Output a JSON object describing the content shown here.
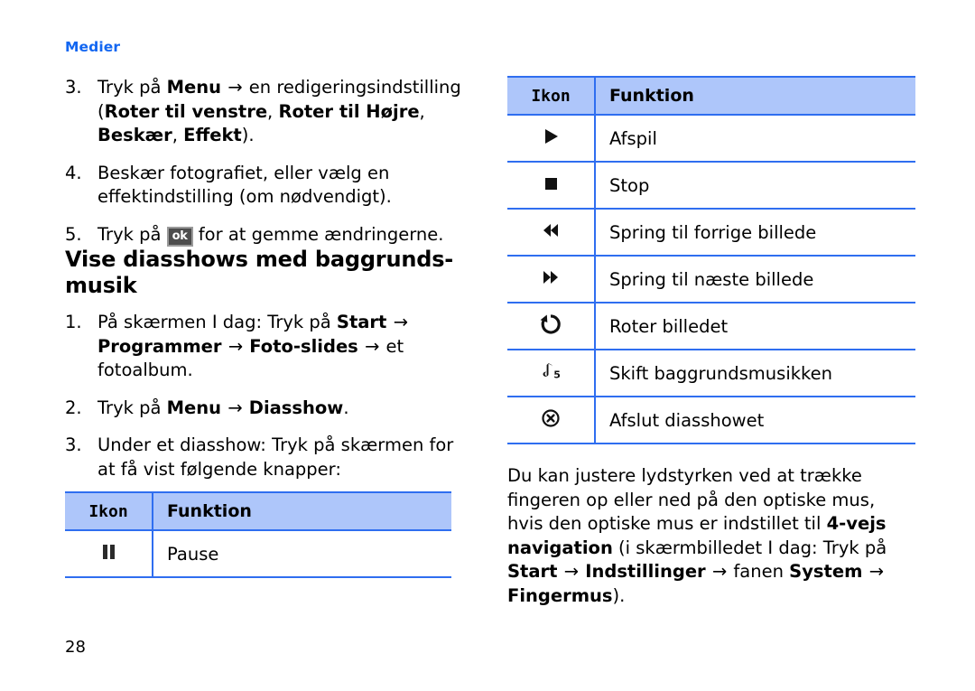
{
  "running_head": "Medier",
  "folio": "28",
  "colors": {
    "accent_blue": "#1266f1",
    "table_border": "#2f6ef0",
    "table_header_fill": "#aec6fa",
    "ok_key_fill": "#4d4d4d"
  },
  "left_column": {
    "steps_photo_edit": [
      {
        "num": "3.",
        "parts": [
          {
            "t": "Tryk på ",
            "b": false
          },
          {
            "t": "Menu",
            "b": true
          },
          {
            "t": " → ",
            "b": false,
            "arrow": true
          },
          {
            "t": "en redigeringsindstilling (",
            "b": false
          },
          {
            "t": "Roter til venstre",
            "b": true
          },
          {
            "t": ", ",
            "b": false
          },
          {
            "t": "Roter til Højre",
            "b": true
          },
          {
            "t": ", ",
            "b": false
          },
          {
            "t": "Beskær",
            "b": true
          },
          {
            "t": ", ",
            "b": false
          },
          {
            "t": "Effekt",
            "b": true
          },
          {
            "t": ").",
            "b": false
          }
        ]
      },
      {
        "num": "4.",
        "parts": [
          {
            "t": "Beskær fotografiet, eller vælg en effektindstilling (om nødvendigt).",
            "b": false
          }
        ]
      },
      {
        "num": "5.",
        "parts": [
          {
            "t": "Tryk på ",
            "b": false
          },
          {
            "t": "ok",
            "key": true
          },
          {
            "t": " for at gemme ændringerne.",
            "b": false
          }
        ]
      }
    ],
    "section_heading": "Vise diasshows med baggrunds-musik",
    "steps_slideshow": [
      {
        "num": "1.",
        "parts": [
          {
            "t": "På skærmen I dag: Tryk på ",
            "b": false
          },
          {
            "t": "Start",
            "b": true
          },
          {
            "t": " → ",
            "b": false,
            "arrow": true
          },
          {
            "t": "Programmer",
            "b": true
          },
          {
            "t": " → ",
            "b": false,
            "arrow": true
          },
          {
            "t": "Foto-slides",
            "b": true
          },
          {
            "t": " → ",
            "b": false,
            "arrow": true
          },
          {
            "t": "et fotoalbum.",
            "b": false
          }
        ]
      },
      {
        "num": "2.",
        "parts": [
          {
            "t": "Tryk på ",
            "b": false
          },
          {
            "t": "Menu",
            "b": true
          },
          {
            "t": " → ",
            "b": false,
            "arrow": true
          },
          {
            "t": "Diasshow",
            "b": true
          },
          {
            "t": ".",
            "b": false
          }
        ]
      },
      {
        "num": "3.",
        "parts": [
          {
            "t": "Under et diasshow: Tryk på skærmen for at få vist følgende knapper:",
            "b": false
          }
        ]
      }
    ],
    "table": {
      "headers": {
        "icon": "Ikon",
        "function": "Funktion"
      },
      "rows": [
        {
          "icon": "pause-icon",
          "function": "Pause"
        }
      ]
    }
  },
  "right_column": {
    "table": {
      "headers": {
        "icon": "Ikon",
        "function": "Funktion"
      },
      "rows": [
        {
          "icon": "play-icon",
          "function": "Afspil"
        },
        {
          "icon": "stop-icon",
          "function": "Stop"
        },
        {
          "icon": "rewind-icon",
          "function": "Spring til forrige billede"
        },
        {
          "icon": "fast-forward-icon",
          "function": "Spring til næste billede"
        },
        {
          "icon": "rotate-icon",
          "function": "Roter billedet"
        },
        {
          "icon": "music-note-5-icon",
          "function": "Skift baggrundsmusikken"
        },
        {
          "icon": "close-circle-icon",
          "function": "Afslut diasshowet"
        }
      ]
    },
    "note": [
      {
        "t": "Du kan justere lydstyrken ved at trække fingeren op eller ned på den optiske mus, hvis den optiske mus er indstillet til ",
        "b": false
      },
      {
        "t": "4-vejs navigation",
        "b": true
      },
      {
        "t": " (i skærmbilledet I dag: Tryk på ",
        "b": false
      },
      {
        "t": "Start",
        "b": true
      },
      {
        "t": " → ",
        "b": false,
        "arrow": true
      },
      {
        "t": "Indstillinger",
        "b": true
      },
      {
        "t": " → ",
        "b": false,
        "arrow": true
      },
      {
        "t": "fanen ",
        "b": false
      },
      {
        "t": "System",
        "b": true
      },
      {
        "t": " → ",
        "b": false,
        "arrow": true
      },
      {
        "t": "Fingermus",
        "b": true
      },
      {
        "t": ").",
        "b": false
      }
    ]
  }
}
